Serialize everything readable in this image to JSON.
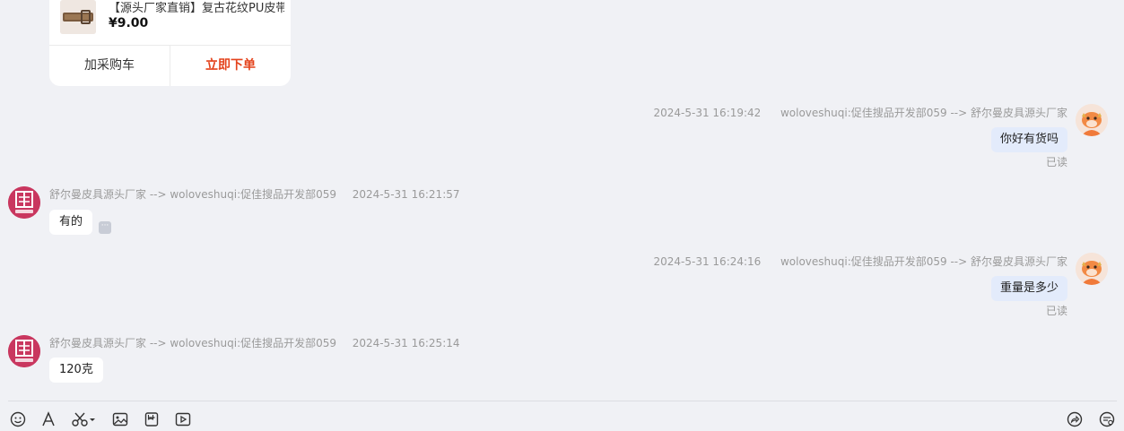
{
  "product_card": {
    "title": "【源头厂家直销】复古花纹PU皮带",
    "price": "¥9.00",
    "add_cart_label": "加采购车",
    "buy_now_label": "立即下单"
  },
  "messages": [
    {
      "direction": "out",
      "timestamp": "2024-5-31 16:19:42",
      "route": "woloveshuqi:促佳搜品开发部059 --> 舒尔曼皮具源头厂家",
      "text": "你好有货吗",
      "status": "已读"
    },
    {
      "direction": "in",
      "route": "舒尔曼皮具源头厂家 --> woloveshuqi:促佳搜品开发部059",
      "timestamp": "2024-5-31 16:21:57",
      "text": "有的"
    },
    {
      "direction": "out",
      "timestamp": "2024-5-31 16:24:16",
      "route": "woloveshuqi:促佳搜品开发部059 --> 舒尔曼皮具源头厂家",
      "text": "重量是多少",
      "status": "已读"
    },
    {
      "direction": "in",
      "route": "舒尔曼皮具源头厂家 --> woloveshuqi:促佳搜品开发部059",
      "timestamp": "2024-5-31 16:25:14",
      "text": "120克"
    }
  ],
  "toolbar": {
    "left_icons": [
      "emoji-icon",
      "font-icon",
      "scissors-icon",
      "image-icon",
      "file-icon",
      "video-icon"
    ],
    "right_icons": [
      "share-icon",
      "quick-reply-icon"
    ]
  },
  "colors": {
    "background": "#f0f1f5",
    "bubble_out": "#e3ebfb",
    "bubble_in": "#ffffff",
    "buy_accent": "#e4431c"
  }
}
